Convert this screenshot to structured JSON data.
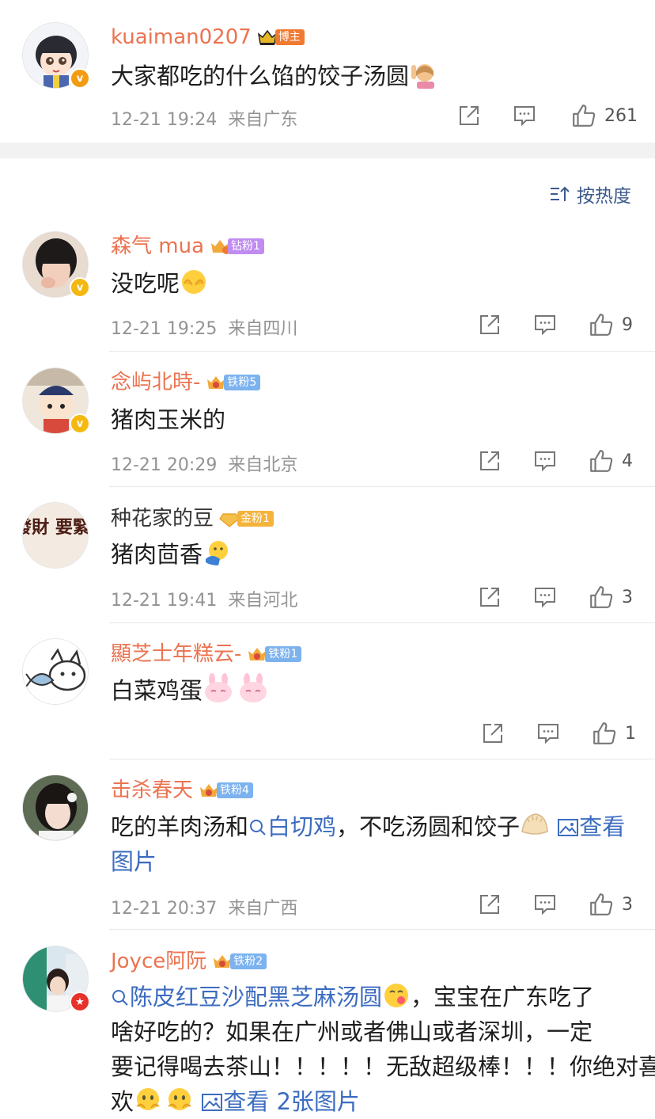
{
  "post": {
    "username": "kuaiman0207",
    "badge": "博主",
    "text": "大家都吃的什么馅的饺子汤圆",
    "time": "12-21 19:24",
    "location": "来自广东",
    "likes": "261"
  },
  "sort_label": "按热度",
  "comments": [
    {
      "username": "森气 mua",
      "fan_badge": "钻粉1",
      "text": "没吃呢",
      "time": "12-21 19:25",
      "location": "来自四川",
      "likes": "9"
    },
    {
      "username": "念屿北時-",
      "fan_badge": "铁粉5",
      "text": "猪肉玉米的",
      "time": "12-21 20:29",
      "location": "来自北京",
      "likes": "4"
    },
    {
      "username": "种花家的豆",
      "fan_badge": "金粉1",
      "text": "猪肉茴香",
      "time": "12-21 19:41",
      "location": "来自河北",
      "likes": "3",
      "avatar_text": "發財 要緊!"
    },
    {
      "username": "顯芝士年糕云-",
      "fan_badge": "铁粉1",
      "text": "白菜鸡蛋",
      "time": "",
      "location": "",
      "likes": "1"
    },
    {
      "username": "击杀春天",
      "fan_badge": "铁粉4",
      "text_before": "吃的羊肉汤和",
      "topic": "白切鸡",
      "text_after": "，不吃汤圆和饺子",
      "view_image": "查看图片",
      "time": "12-21 20:37",
      "location": "来自广西",
      "likes": "3"
    },
    {
      "username": "Joyce阿阮",
      "fan_badge": "铁粉2",
      "topic": "陈皮红豆沙配黑芝麻汤圆",
      "line1_after": "，宝宝在广东吃了",
      "line2": "啥好吃的？如果在广州或者佛山或者深圳，一定",
      "line3": "要记得喝去茶山！！！！！无敌超级棒！！！你绝对喜",
      "line4": "欢",
      "view_images": "查看 2张图片"
    }
  ],
  "colors": {
    "username_orange": "#eb7350",
    "link_blue": "#3c6cc0",
    "meta_gray": "#939393",
    "verified_orange": "#f39c12",
    "verified_yellow": "#f5b80f",
    "verified_red": "#e6322b",
    "diamond_pill": "#c08cf0",
    "iron_pill": "#7cb2ee",
    "gold_pill": "#f5b33a",
    "blogger_pill": "#f07a31"
  }
}
